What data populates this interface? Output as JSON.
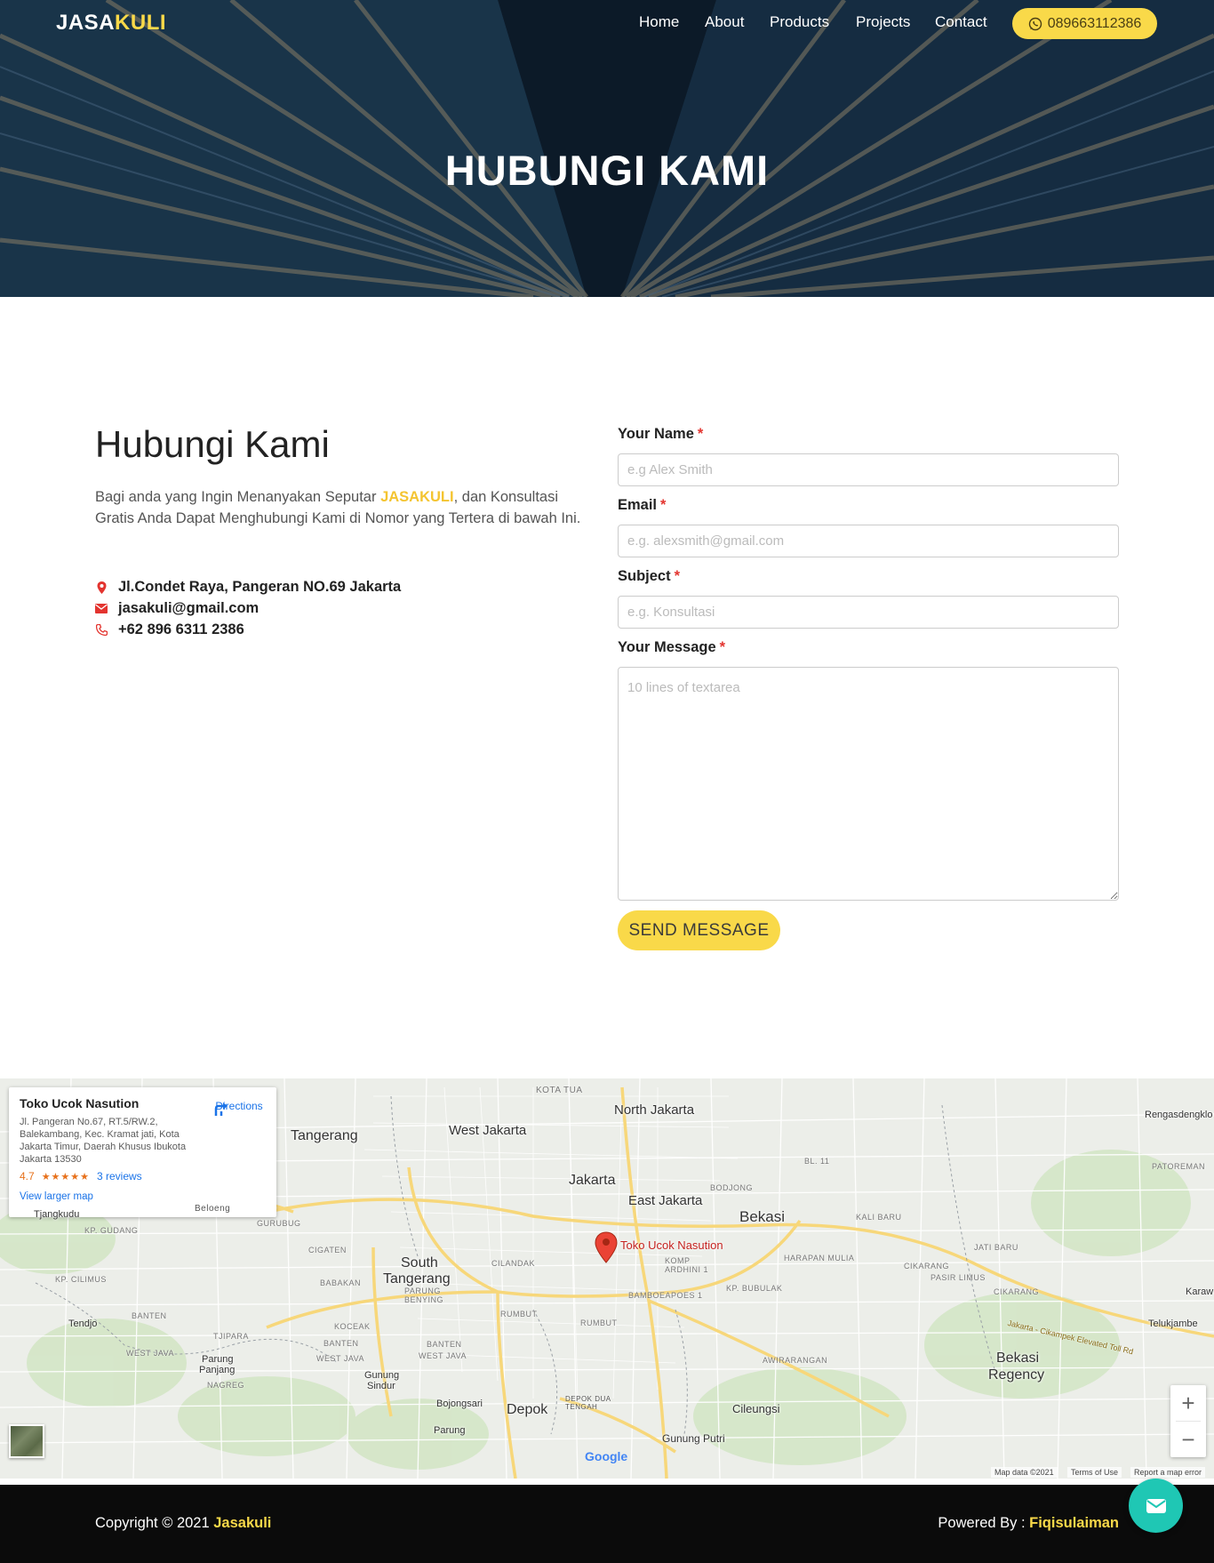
{
  "nav": {
    "logo_part1": "JASA",
    "logo_part2": "KULI",
    "links": [
      "Home",
      "About",
      "Products",
      "Projects",
      "Contact"
    ],
    "phone": "089663112386"
  },
  "hero": {
    "title": "HUBUNGI KAMI"
  },
  "contact": {
    "heading": "Hubungi Kami",
    "desc_before": "Bagi anda yang Ingin Menanyakan Seputar ",
    "desc_brand": "JASAKULI",
    "desc_after": ", dan Konsultasi Gratis Anda Dapat Menghubungi Kami di Nomor yang Tertera di bawah Ini.",
    "address": "Jl.Condet Raya, Pangeran NO.69 Jakarta",
    "email": "jasakuli@gmail.com",
    "phone": "+62 896 6311 2386"
  },
  "form": {
    "name_label": "Your Name",
    "name_placeholder": "e.g Alex Smith",
    "email_label": "Email",
    "email_placeholder": "e.g. alexsmith@gmail.com",
    "subject_label": "Subject",
    "subject_placeholder": "e.g. Konsultasi",
    "message_label": "Your Message",
    "message_placeholder": "10 lines of textarea",
    "required_mark": "*",
    "submit": "SEND MESSAGE"
  },
  "map": {
    "place_name": "Toko Ucok Nasution",
    "place_address": "Jl. Pangeran No.67, RT.5/RW.2, Balekambang, Kec. Kramat jati, Kota Jakarta Timur, Daerah Khusus Ibukota Jakarta 13530",
    "rating": "4.7",
    "stars": "★★★★★",
    "reviews": "3 reviews",
    "directions": "Directions",
    "larger_map": "View larger map",
    "pin_label": "Toko Ucok Nasution",
    "labels": {
      "north_jakarta": "North Jakarta",
      "west_jakarta": "West Jakarta",
      "tangerang": "Tangerang",
      "jakarta": "Jakarta",
      "east_jakarta": "East Jakarta",
      "bekasi": "Bekasi",
      "south_tangerang_1": "South",
      "south_tangerang_2": "Tangerang",
      "depok": "Depok",
      "cileungsi": "Cileungsi",
      "bekasi_regency_1": "Bekasi",
      "bekasi_regency_2": "Regency",
      "tjangkudu": "Tjangkudu",
      "tendjo": "Tendjo",
      "parung_panjang_1": "Parung",
      "parung_panjang_2": "Panjang",
      "gunung_sindur_1": "Gunung",
      "gunung_sindur_2": "Sindur",
      "bojongsari": "Bojongsari",
      "parung": "Parung",
      "gunung_putri": "Gunung Putri",
      "telukjambe": "Telukjambe",
      "rengasdengklok": "Rengasdengklo",
      "karawang": "Karaw"
    },
    "small_labels": {
      "kota_tua": "KOTA TUA",
      "bodjong": "BODJONG",
      "bl11": "BL. 11",
      "kali_baru": "KALI BARU",
      "harapan_mulia": "HARAPAN MULIA",
      "cikarang": "CIKARANG",
      "pasir_limus": "PASIR LIMUS",
      "jati_baru": "JATI BARU",
      "cikarang2": "CIKARANG",
      "patoreman": "PATOREMAN",
      "kp_gudang": "KP. GUDANG",
      "gurubug": "GURUBUG",
      "cigaten": "CIGATEN",
      "kp_cilimus": "KP. CILIMUS",
      "babakan": "BABAKAN",
      "cilandak": "CILANDAK",
      "parung_benying": "PARUNG BENYING",
      "komp_ardhini": "KOMP ARDHINI 1",
      "bamboeapoes": "BAMBOEAPOES 1",
      "kp_bubulak": "KP. BUBULAK",
      "rumbut1": "RUMBUT",
      "rumbut2": "RUMBUT",
      "banten_west_java": "BANTEN",
      "west_java1": "WEST JAVA",
      "tjipara": "TJIPARA",
      "nagreg": "NAGREG",
      "kocheak": "KOCEAK",
      "banten2": "BANTEN",
      "west_java2": "WEST JAVA",
      "banten3": "BANTEN",
      "west_java3": "WEST JAVA",
      "awirarangan": "AWIRARANGAN",
      "depok_dua": "DEPOK DUA TENGAH",
      "beloeng": "Beloeng",
      "toll_road": "Jakarta - Cikampek Elevated Toll Rd"
    },
    "footer": {
      "map_data": "Map data ©2021",
      "terms": "Terms of Use",
      "report": "Report a map error"
    },
    "google": "Google",
    "zoom_in": "+",
    "zoom_out": "−"
  },
  "footer": {
    "copyright_before": "Copyright © 2021 ",
    "copyright_brand": "Jasakuli",
    "powered_before": "Powered By : ",
    "powered_brand": "Fiqisulaiman"
  },
  "colors": {
    "accent": "#f9d949",
    "chat": "#1fc7b4",
    "footer": "#0b0b0b",
    "required": "#e3342f",
    "icon": "#e3342f"
  }
}
